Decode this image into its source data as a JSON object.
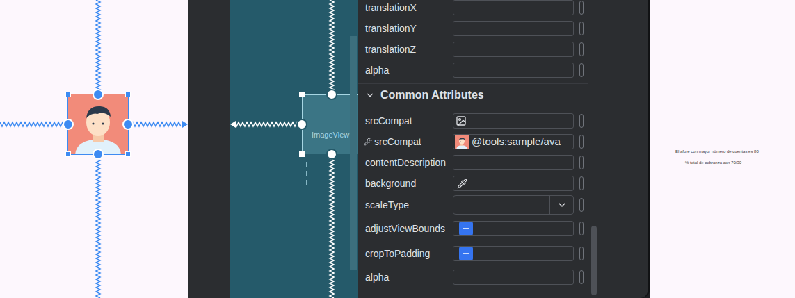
{
  "blueprint": {
    "view_label": "ImageView"
  },
  "attributes_top": [
    {
      "label": "translationX",
      "kind": "field",
      "value": ""
    },
    {
      "label": "translationY",
      "kind": "field",
      "value": ""
    },
    {
      "label": "translationZ",
      "kind": "field",
      "value": ""
    },
    {
      "label": "alpha",
      "kind": "field",
      "value": ""
    }
  ],
  "section": {
    "title": "Common Attributes",
    "expanded": true
  },
  "attributes": [
    {
      "label": "srcCompat",
      "kind": "image",
      "value": ""
    },
    {
      "label": "srcCompat",
      "kind": "tools",
      "value": "@tools:sample/ava"
    },
    {
      "label": "contentDescription",
      "kind": "field",
      "value": ""
    },
    {
      "label": "background",
      "kind": "pencil",
      "value": ""
    },
    {
      "label": "scaleType",
      "kind": "dropdown",
      "value": ""
    },
    {
      "label": "adjustViewBounds",
      "kind": "checkbox",
      "indeterminate": true
    },
    {
      "label": "cropToPadding",
      "kind": "checkbox",
      "indeterminate": true
    },
    {
      "label": "alpha",
      "kind": "field",
      "value": ""
    }
  ],
  "side_text": [
    "El afore con mayor número de cuentas es 80",
    "% total de cobranza con 70/30"
  ]
}
